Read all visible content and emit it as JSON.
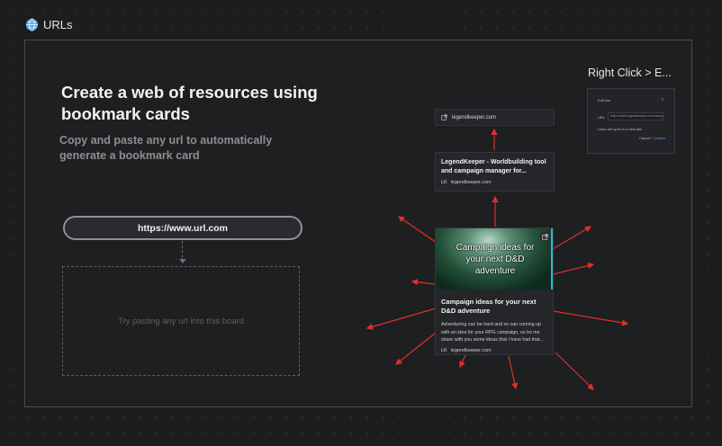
{
  "frame": {
    "label": "URLs",
    "icon": "globe-icon"
  },
  "intro": {
    "headline": "Create a web of resources using bookmark cards",
    "subline": "Copy and paste any url to automatically generate a bookmark card"
  },
  "url_input": {
    "value": "https://www.url.com"
  },
  "dropzone": {
    "placeholder": "Try pasting any url into this board"
  },
  "cards": {
    "small": {
      "domain": "legendkeeper.com",
      "icon": "external-link-icon"
    },
    "mid": {
      "title": "LegendKeeper - Worldbuilding tool and campaign manager for...",
      "favicon": "LK",
      "domain": "legendkeeper.com"
    },
    "big": {
      "image_caption": "Campaign ideas for your next D&D adventure",
      "title": "Campaign ideas for your next D&D adventure",
      "description": "Adventuring can be hard and so can coming up with an idea for your RPG campaign, so let me share with you some ideas that I have had that...",
      "favicon": "LK",
      "domain": "legendkeeper.com"
    }
  },
  "right_click": {
    "title": "Right Click > E...",
    "dialog": {
      "header": "Edit link",
      "close": "×",
      "field_label": "URL",
      "field_value": "https://www.legendkeeper.com/campaign-ideas",
      "hint": "Links will open in a new tab.",
      "cancel": "Cancel",
      "confirm": "Confirm"
    }
  },
  "colors": {
    "arrow": "#e0302a",
    "accent_edge": "#2fb7d6",
    "background": "#1c1d1f"
  }
}
